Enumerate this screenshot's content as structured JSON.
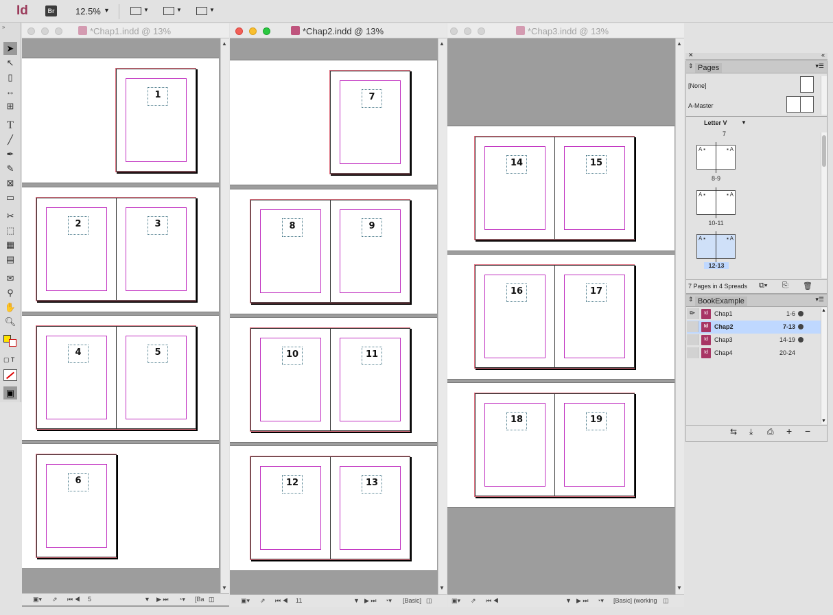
{
  "app": {
    "logo": "Id",
    "bridge_label": "Br",
    "zoom_value": "12.5%"
  },
  "documents": [
    {
      "title": "*Chap1.indd @ 13%",
      "status": {
        "page": "5",
        "preflight": "[Ba"
      },
      "spreads": [
        [
          "1"
        ],
        [
          "2",
          "3"
        ],
        [
          "4",
          "5"
        ],
        [
          "6"
        ]
      ]
    },
    {
      "title": "*Chap2.indd @ 13%",
      "status": {
        "page": "11",
        "preflight": "[Basic]"
      },
      "spreads": [
        [
          "7"
        ],
        [
          "8",
          "9"
        ],
        [
          "10",
          "11"
        ],
        [
          "12",
          "13"
        ]
      ]
    },
    {
      "title": "*Chap3.indd @ 13%",
      "status": {
        "page": "",
        "preflight": "[Basic] (working"
      },
      "spreads": [
        [
          "14",
          "15"
        ],
        [
          "16",
          "17"
        ],
        [
          "18",
          "19"
        ]
      ]
    }
  ],
  "pages_panel": {
    "tab": "Pages",
    "masters": [
      {
        "label": "[None]"
      },
      {
        "label": "A-Master"
      }
    ],
    "size_label": "Letter V",
    "top_label": "7",
    "spreads": [
      {
        "label": "8-9",
        "selected": false
      },
      {
        "label": "10-11",
        "selected": false
      },
      {
        "label": "12-13",
        "selected": true
      }
    ],
    "footer": "7 Pages in 4 Spreads"
  },
  "book_panel": {
    "tab": "BookExample",
    "chapters": [
      {
        "name": "Chap1",
        "range": "1-6",
        "selected": false
      },
      {
        "name": "Chap2",
        "range": "7-13",
        "selected": true
      },
      {
        "name": "Chap3",
        "range": "14-19",
        "selected": false
      },
      {
        "name": "Chap4",
        "range": "20-24",
        "selected": false
      }
    ]
  },
  "colors": {
    "margin_guide": "#c02ec0",
    "bleed_guide": "#e07080",
    "selection": "#bfd8ff"
  }
}
